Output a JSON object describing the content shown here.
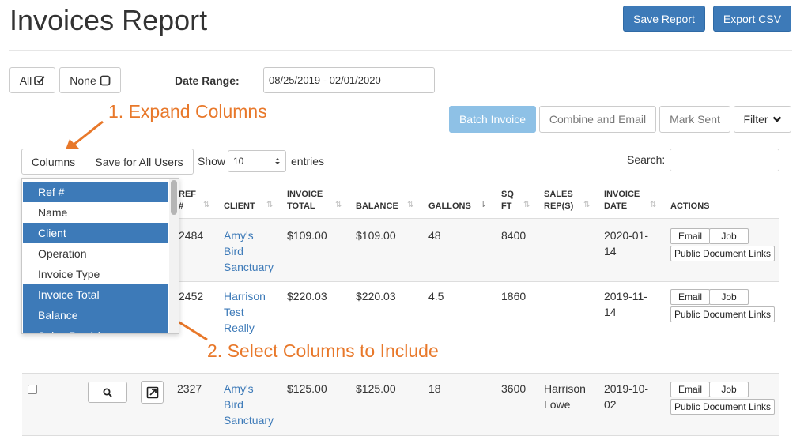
{
  "header": {
    "title": "Invoices Report",
    "save_report": "Save Report",
    "export_csv": "Export CSV"
  },
  "filters": {
    "all_label": "All",
    "none_label": "None",
    "date_range_label": "Date Range:",
    "date_range_value": "08/25/2019 - 02/01/2020"
  },
  "actions": {
    "batch_invoice": "Batch Invoice",
    "combine_email": "Combine and Email",
    "mark_sent": "Mark Sent",
    "filter": "Filter"
  },
  "annotations": {
    "step1": "1. Expand Columns",
    "step2": "2. Select Columns to Include",
    "color": "#e8782a"
  },
  "toolbar": {
    "columns": "Columns",
    "save_all_users": "Save for All Users",
    "show": "Show",
    "entries_value": "10",
    "entries": "entries",
    "search_label": "Search:"
  },
  "dropdown": {
    "items": [
      {
        "label": "Ref #",
        "selected": true
      },
      {
        "label": "Name",
        "selected": false
      },
      {
        "label": "Client",
        "selected": true
      },
      {
        "label": "Operation",
        "selected": false
      },
      {
        "label": "Invoice Type",
        "selected": false
      },
      {
        "label": "Invoice Total",
        "selected": true
      },
      {
        "label": "Balance",
        "selected": true
      },
      {
        "label": "Sales Rep(s)",
        "selected": true
      }
    ]
  },
  "table": {
    "headers": {
      "ref_1": "Ref",
      "ref_2": "#",
      "client": "Client",
      "invoice_total_1": "Invoice",
      "invoice_total_2": "Total",
      "balance": "Balance",
      "gallons": "Gallons",
      "sqft_1": "Sq",
      "sqft_2": "Ft",
      "sales_1": "Sales",
      "sales_2": "Rep(s)",
      "invoice_date_1": "Invoice",
      "invoice_date_2": "Date",
      "actions": "Actions"
    },
    "rows": [
      {
        "ref": "2484",
        "client_1": "Amy's",
        "client_2": "Bird",
        "client_3": "Sanctuary",
        "total": "$109.00",
        "balance": "$109.00",
        "gallons": "48",
        "sqft": "8400",
        "rep_1": "",
        "rep_2": "",
        "date_1": "2020-01-",
        "date_2": "14"
      },
      {
        "ref": "2452",
        "client_1": "Harrison",
        "client_2": "Test",
        "client_3": "Really",
        "total": "$220.03",
        "balance": "$220.03",
        "gallons": "4.5",
        "sqft": "1860",
        "rep_1": "",
        "rep_2": "",
        "date_1": "2019-11-",
        "date_2": "14"
      },
      {
        "ref": "2327",
        "client_1": "Amy's",
        "client_2": "Bird",
        "client_3": "Sanctuary",
        "total": "$125.00",
        "balance": "$125.00",
        "gallons": "18",
        "sqft": "3600",
        "rep_1": "Harrison",
        "rep_2": "Lowe",
        "date_1": "2019-10-",
        "date_2": "02"
      }
    ],
    "row_actions": {
      "email": "Email",
      "job": "Job",
      "public_links": "Public Document Links"
    }
  },
  "icons": {
    "check": "check-square-icon",
    "square": "square-icon",
    "caret": "chevron-down-icon",
    "search": "search-icon",
    "open": "external-link-icon"
  }
}
